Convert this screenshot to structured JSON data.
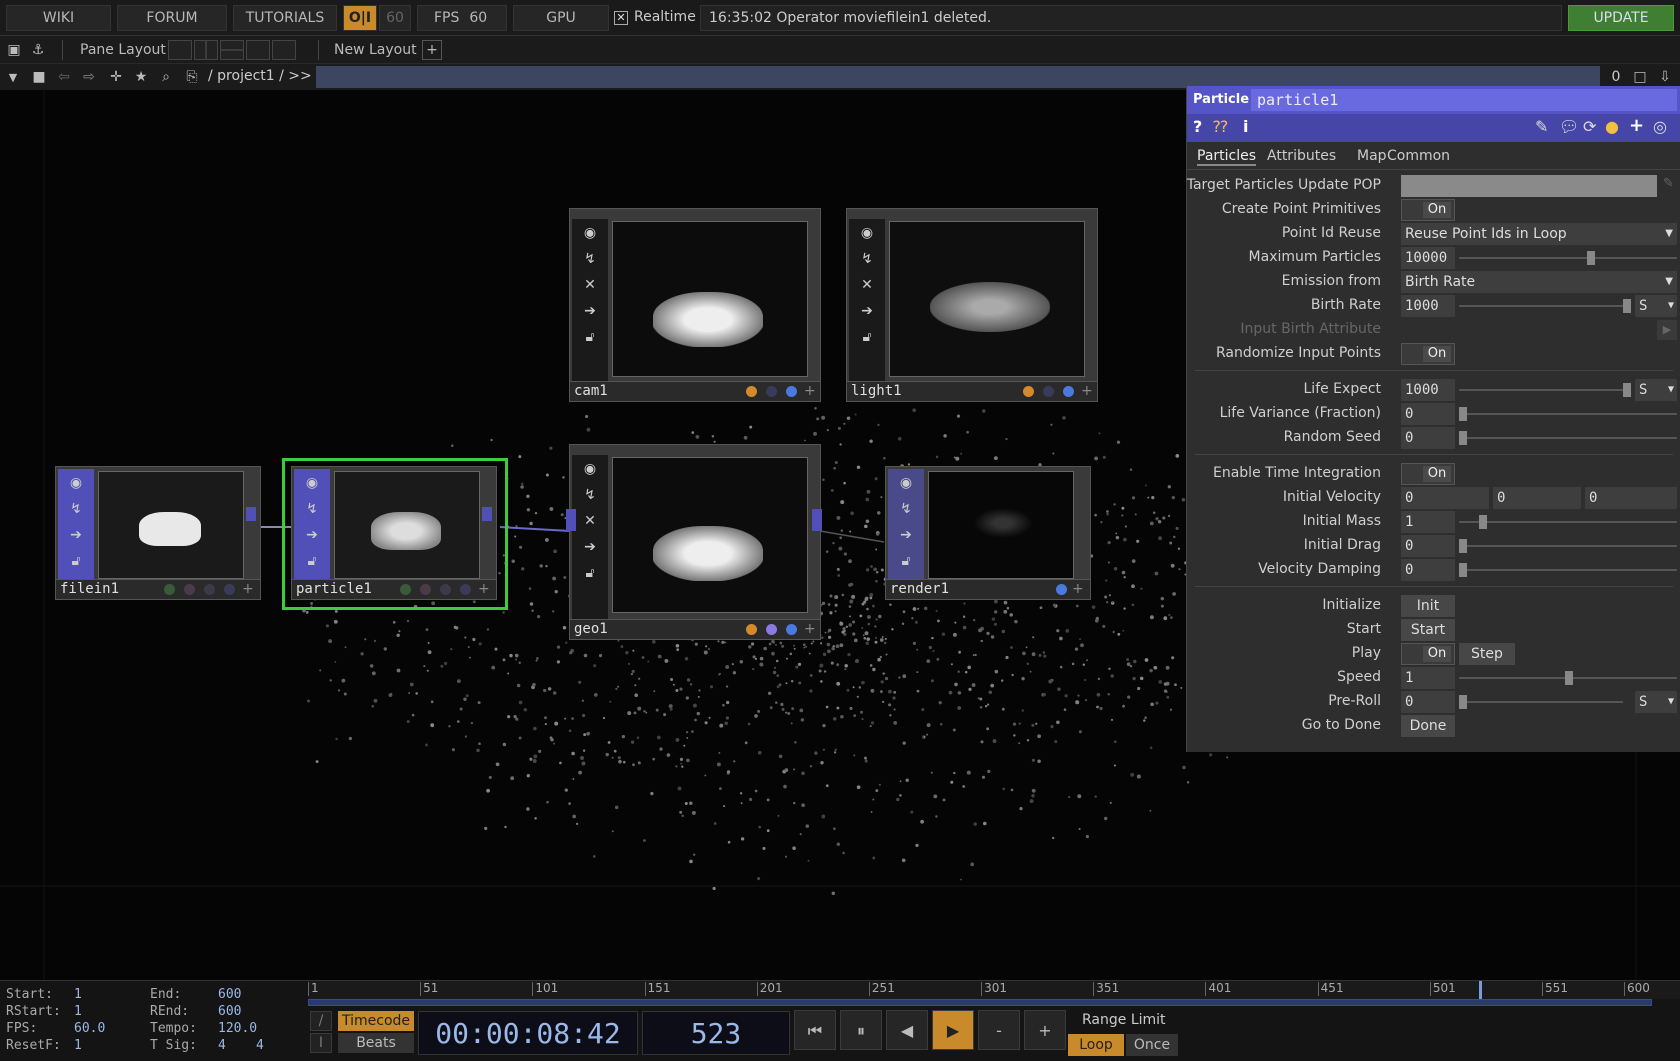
{
  "topbar": {
    "wiki": "WIKI",
    "forum": "FORUM",
    "tutorials": "TUTORIALS",
    "oi": "O|I",
    "fps_cap": "60",
    "fps_label": "FPS",
    "fps_value": "60",
    "gpu": "GPU",
    "realtime_check": "✕",
    "realtime": "Realtime",
    "message": "16:35:02 Operator moviefilein1 deleted.",
    "update": "UPDATE"
  },
  "layoutbar": {
    "pane_layout": "Pane Layout",
    "new_layout": "New Layout",
    "plus": "+"
  },
  "pathbar": {
    "path": "/ project1 / >>",
    "counter": "0"
  },
  "nodes": {
    "filein1": "filein1",
    "particle1": "particle1",
    "geo1": "geo1",
    "cam1": "cam1",
    "light1": "light1",
    "render1": "render1"
  },
  "params": {
    "op_type": "Particle",
    "op_name": "particle1",
    "tabs": [
      "Particles",
      "Attributes",
      "Map",
      "Common"
    ],
    "target_pop_label": "Target Particles Update POP",
    "create_point_label": "Create Point Primitives",
    "create_point_val": "On",
    "point_id_label": "Point Id Reuse",
    "point_id_val": "Reuse Point Ids in Loop",
    "max_particles_label": "Maximum Particles",
    "max_particles_val": "10000",
    "emission_label": "Emission from",
    "emission_val": "Birth Rate",
    "birth_rate_label": "Birth Rate",
    "birth_rate_val": "1000",
    "birth_rate_unit": "S",
    "input_birth_label": "Input Birth Attribute",
    "randomize_label": "Randomize Input Points",
    "randomize_val": "On",
    "life_expect_label": "Life Expect",
    "life_expect_val": "1000",
    "life_expect_unit": "S",
    "life_var_label": "Life Variance (Fraction)",
    "life_var_val": "0",
    "random_seed_label": "Random Seed",
    "random_seed_val": "0",
    "enable_time_label": "Enable Time Integration",
    "enable_time_val": "On",
    "init_vel_label": "Initial Velocity",
    "init_vel_x": "0",
    "init_vel_y": "0",
    "init_vel_z": "0",
    "init_mass_label": "Initial Mass",
    "init_mass_val": "1",
    "init_drag_label": "Initial Drag",
    "init_drag_val": "0",
    "vel_damp_label": "Velocity Damping",
    "vel_damp_val": "0",
    "initialize_label": "Initialize",
    "initialize_btn": "Init",
    "start_label": "Start",
    "start_btn": "Start",
    "play_label": "Play",
    "play_val": "On",
    "step_btn": "Step",
    "speed_label": "Speed",
    "speed_val": "1",
    "preroll_label": "Pre-Roll",
    "preroll_val": "0",
    "preroll_unit": "S",
    "goto_done_label": "Go to Done",
    "done_btn": "Done"
  },
  "timeline": {
    "start_k": "Start:",
    "start_v": "1",
    "end_k": "End:",
    "end_v": "600",
    "rstart_k": "RStart:",
    "rstart_v": "1",
    "rend_k": "REnd:",
    "rend_v": "600",
    "fps_k": "FPS:",
    "fps_v": "60.0",
    "tempo_k": "Tempo:",
    "tempo_v": "120.0",
    "resetf_k": "ResetF:",
    "resetf_v": "1",
    "tsig_k": "T Sig:",
    "tsig_a": "4",
    "tsig_b": "4",
    "ticks": [
      "1",
      "51",
      "101",
      "151",
      "201",
      "251",
      "301",
      "351",
      "401",
      "451",
      "501",
      "551",
      "600"
    ],
    "playhead_frame": 523,
    "timecode_btn": "Timecode",
    "beats_btn": "Beats",
    "timecode": "00:00:08:42",
    "frame": "523",
    "range_limit": "Range Limit",
    "loop": "Loop",
    "once": "Once",
    "minus": "-",
    "plus": "+"
  }
}
